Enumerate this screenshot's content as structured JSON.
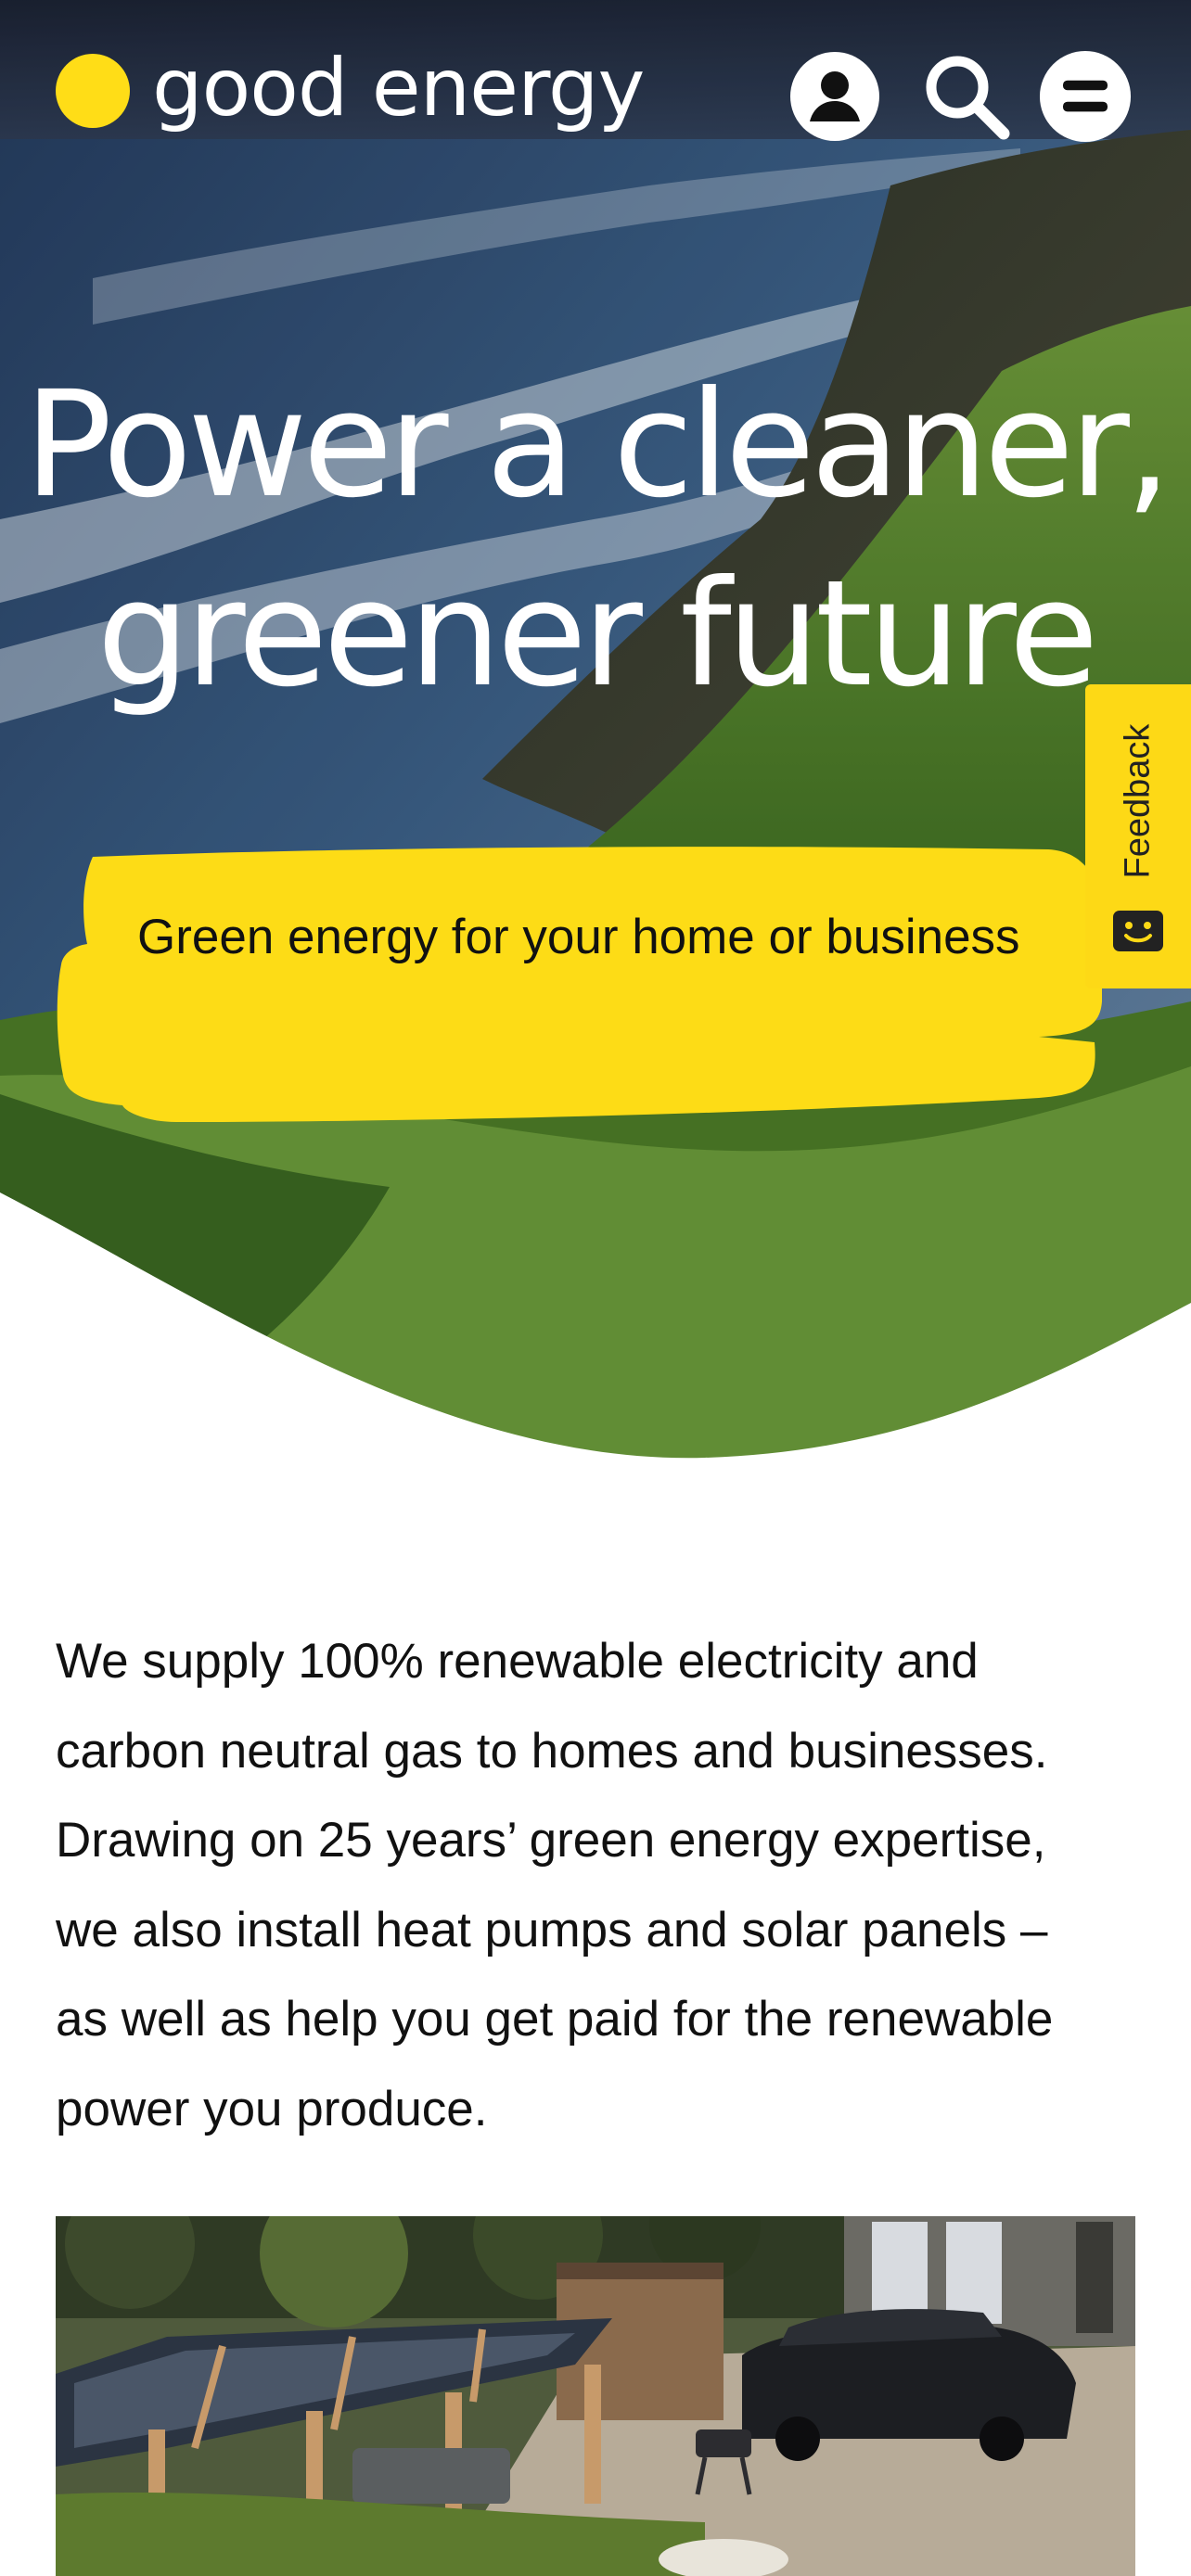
{
  "brand": {
    "name": "good energy",
    "accent_color": "#ffdd17"
  },
  "header": {
    "account_icon": "account-icon",
    "search_icon": "search-icon",
    "menu_icon": "menu-icon"
  },
  "hero": {
    "headline_line1": "Power a cleaner,",
    "headline_line2": "greener future",
    "cta_label": "Green energy for your home or business"
  },
  "feedback": {
    "label": "Feedback",
    "icon": "smiley-icon"
  },
  "intro": {
    "lines": [
      "We supply 100% renewable electricity and",
      "carbon neutral gas to homes and businesses.",
      "Drawing on 25 years’ green energy expertise,",
      "we also install heat pumps and solar panels –",
      "as well as help you get paid for the renewable",
      "power you produce."
    ]
  }
}
